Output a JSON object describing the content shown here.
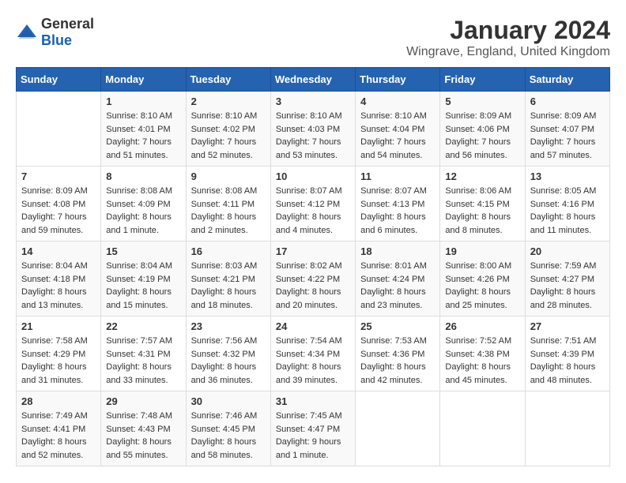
{
  "header": {
    "logo_general": "General",
    "logo_blue": "Blue",
    "month": "January 2024",
    "location": "Wingrave, England, United Kingdom"
  },
  "weekdays": [
    "Sunday",
    "Monday",
    "Tuesday",
    "Wednesday",
    "Thursday",
    "Friday",
    "Saturday"
  ],
  "weeks": [
    [
      {
        "day": "",
        "sunrise": "",
        "sunset": "",
        "daylight": ""
      },
      {
        "day": "1",
        "sunrise": "Sunrise: 8:10 AM",
        "sunset": "Sunset: 4:01 PM",
        "daylight": "Daylight: 7 hours and 51 minutes."
      },
      {
        "day": "2",
        "sunrise": "Sunrise: 8:10 AM",
        "sunset": "Sunset: 4:02 PM",
        "daylight": "Daylight: 7 hours and 52 minutes."
      },
      {
        "day": "3",
        "sunrise": "Sunrise: 8:10 AM",
        "sunset": "Sunset: 4:03 PM",
        "daylight": "Daylight: 7 hours and 53 minutes."
      },
      {
        "day": "4",
        "sunrise": "Sunrise: 8:10 AM",
        "sunset": "Sunset: 4:04 PM",
        "daylight": "Daylight: 7 hours and 54 minutes."
      },
      {
        "day": "5",
        "sunrise": "Sunrise: 8:09 AM",
        "sunset": "Sunset: 4:06 PM",
        "daylight": "Daylight: 7 hours and 56 minutes."
      },
      {
        "day": "6",
        "sunrise": "Sunrise: 8:09 AM",
        "sunset": "Sunset: 4:07 PM",
        "daylight": "Daylight: 7 hours and 57 minutes."
      }
    ],
    [
      {
        "day": "7",
        "sunrise": "Sunrise: 8:09 AM",
        "sunset": "Sunset: 4:08 PM",
        "daylight": "Daylight: 7 hours and 59 minutes."
      },
      {
        "day": "8",
        "sunrise": "Sunrise: 8:08 AM",
        "sunset": "Sunset: 4:09 PM",
        "daylight": "Daylight: 8 hours and 1 minute."
      },
      {
        "day": "9",
        "sunrise": "Sunrise: 8:08 AM",
        "sunset": "Sunset: 4:11 PM",
        "daylight": "Daylight: 8 hours and 2 minutes."
      },
      {
        "day": "10",
        "sunrise": "Sunrise: 8:07 AM",
        "sunset": "Sunset: 4:12 PM",
        "daylight": "Daylight: 8 hours and 4 minutes."
      },
      {
        "day": "11",
        "sunrise": "Sunrise: 8:07 AM",
        "sunset": "Sunset: 4:13 PM",
        "daylight": "Daylight: 8 hours and 6 minutes."
      },
      {
        "day": "12",
        "sunrise": "Sunrise: 8:06 AM",
        "sunset": "Sunset: 4:15 PM",
        "daylight": "Daylight: 8 hours and 8 minutes."
      },
      {
        "day": "13",
        "sunrise": "Sunrise: 8:05 AM",
        "sunset": "Sunset: 4:16 PM",
        "daylight": "Daylight: 8 hours and 11 minutes."
      }
    ],
    [
      {
        "day": "14",
        "sunrise": "Sunrise: 8:04 AM",
        "sunset": "Sunset: 4:18 PM",
        "daylight": "Daylight: 8 hours and 13 minutes."
      },
      {
        "day": "15",
        "sunrise": "Sunrise: 8:04 AM",
        "sunset": "Sunset: 4:19 PM",
        "daylight": "Daylight: 8 hours and 15 minutes."
      },
      {
        "day": "16",
        "sunrise": "Sunrise: 8:03 AM",
        "sunset": "Sunset: 4:21 PM",
        "daylight": "Daylight: 8 hours and 18 minutes."
      },
      {
        "day": "17",
        "sunrise": "Sunrise: 8:02 AM",
        "sunset": "Sunset: 4:22 PM",
        "daylight": "Daylight: 8 hours and 20 minutes."
      },
      {
        "day": "18",
        "sunrise": "Sunrise: 8:01 AM",
        "sunset": "Sunset: 4:24 PM",
        "daylight": "Daylight: 8 hours and 23 minutes."
      },
      {
        "day": "19",
        "sunrise": "Sunrise: 8:00 AM",
        "sunset": "Sunset: 4:26 PM",
        "daylight": "Daylight: 8 hours and 25 minutes."
      },
      {
        "day": "20",
        "sunrise": "Sunrise: 7:59 AM",
        "sunset": "Sunset: 4:27 PM",
        "daylight": "Daylight: 8 hours and 28 minutes."
      }
    ],
    [
      {
        "day": "21",
        "sunrise": "Sunrise: 7:58 AM",
        "sunset": "Sunset: 4:29 PM",
        "daylight": "Daylight: 8 hours and 31 minutes."
      },
      {
        "day": "22",
        "sunrise": "Sunrise: 7:57 AM",
        "sunset": "Sunset: 4:31 PM",
        "daylight": "Daylight: 8 hours and 33 minutes."
      },
      {
        "day": "23",
        "sunrise": "Sunrise: 7:56 AM",
        "sunset": "Sunset: 4:32 PM",
        "daylight": "Daylight: 8 hours and 36 minutes."
      },
      {
        "day": "24",
        "sunrise": "Sunrise: 7:54 AM",
        "sunset": "Sunset: 4:34 PM",
        "daylight": "Daylight: 8 hours and 39 minutes."
      },
      {
        "day": "25",
        "sunrise": "Sunrise: 7:53 AM",
        "sunset": "Sunset: 4:36 PM",
        "daylight": "Daylight: 8 hours and 42 minutes."
      },
      {
        "day": "26",
        "sunrise": "Sunrise: 7:52 AM",
        "sunset": "Sunset: 4:38 PM",
        "daylight": "Daylight: 8 hours and 45 minutes."
      },
      {
        "day": "27",
        "sunrise": "Sunrise: 7:51 AM",
        "sunset": "Sunset: 4:39 PM",
        "daylight": "Daylight: 8 hours and 48 minutes."
      }
    ],
    [
      {
        "day": "28",
        "sunrise": "Sunrise: 7:49 AM",
        "sunset": "Sunset: 4:41 PM",
        "daylight": "Daylight: 8 hours and 52 minutes."
      },
      {
        "day": "29",
        "sunrise": "Sunrise: 7:48 AM",
        "sunset": "Sunset: 4:43 PM",
        "daylight": "Daylight: 8 hours and 55 minutes."
      },
      {
        "day": "30",
        "sunrise": "Sunrise: 7:46 AM",
        "sunset": "Sunset: 4:45 PM",
        "daylight": "Daylight: 8 hours and 58 minutes."
      },
      {
        "day": "31",
        "sunrise": "Sunrise: 7:45 AM",
        "sunset": "Sunset: 4:47 PM",
        "daylight": "Daylight: 9 hours and 1 minute."
      },
      {
        "day": "",
        "sunrise": "",
        "sunset": "",
        "daylight": ""
      },
      {
        "day": "",
        "sunrise": "",
        "sunset": "",
        "daylight": ""
      },
      {
        "day": "",
        "sunrise": "",
        "sunset": "",
        "daylight": ""
      }
    ]
  ]
}
